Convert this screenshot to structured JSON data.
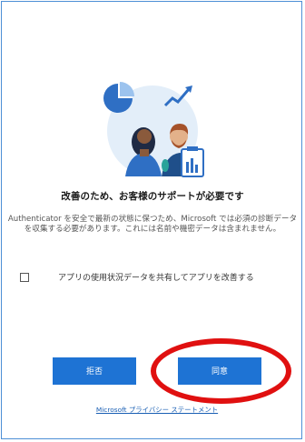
{
  "dialog": {
    "title": "改善のため、お客様のサポートが必要です",
    "description": "Authenticator を安全で最新の状態に保つため、Microsoft では必須の診断データを収集する必要があります。これには名前や機密データは含まれません。",
    "consent_label": "アプリの使用状況データを共有してアプリを改善する",
    "consent_checked": false,
    "reject_label": "拒否",
    "agree_label": "同意",
    "privacy_link": "Microsoft プライバシー ステートメント"
  },
  "colors": {
    "accent": "#1e73d4",
    "frame_border": "#4d8fd6",
    "highlight_ring": "#e01010",
    "link": "#1a5fb4"
  },
  "icons": {
    "illustration": "people-with-charts-illustration",
    "checkbox": "checkbox-unchecked-icon"
  }
}
